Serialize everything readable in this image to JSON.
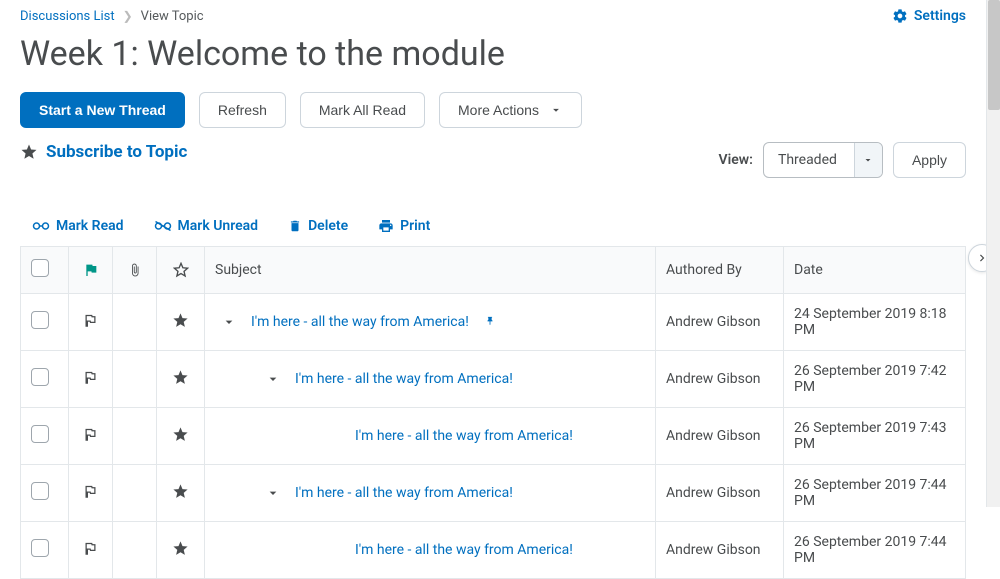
{
  "breadcrumb": {
    "root": "Discussions List",
    "current": "View Topic"
  },
  "settings_label": "Settings",
  "page_title": "Week 1: Welcome to the module",
  "toolbar": {
    "start_thread": "Start a New Thread",
    "refresh": "Refresh",
    "mark_all_read": "Mark All Read",
    "more_actions": "More Actions"
  },
  "subscribe_label": "Subscribe to Topic",
  "view": {
    "label": "View:",
    "selected": "Threaded",
    "apply": "Apply"
  },
  "actions": {
    "mark_read": "Mark Read",
    "mark_unread": "Mark Unread",
    "delete": "Delete",
    "print": "Print"
  },
  "columns": {
    "subject": "Subject",
    "author": "Authored By",
    "date": "Date"
  },
  "rows": [
    {
      "subject": "I'm here - all the way from America!",
      "pinned": true,
      "caret": true,
      "indent": 0,
      "author": "Andrew Gibson",
      "date": "24 September 2019 8:18 PM"
    },
    {
      "subject": "I'm here - all the way from America!",
      "pinned": false,
      "caret": true,
      "indent": 1,
      "author": "Andrew Gibson",
      "date": "26 September 2019 7:42 PM"
    },
    {
      "subject": "I'm here - all the way from America!",
      "pinned": false,
      "caret": false,
      "indent": 2,
      "author": "Andrew Gibson",
      "date": "26 September 2019 7:43 PM"
    },
    {
      "subject": "I'm here - all the way from America!",
      "pinned": false,
      "caret": true,
      "indent": 1,
      "author": "Andrew Gibson",
      "date": "26 September 2019 7:44 PM"
    },
    {
      "subject": "I'm here - all the way from America!",
      "pinned": false,
      "caret": false,
      "indent": 2,
      "author": "Andrew Gibson",
      "date": "26 September 2019 7:44 PM"
    }
  ]
}
